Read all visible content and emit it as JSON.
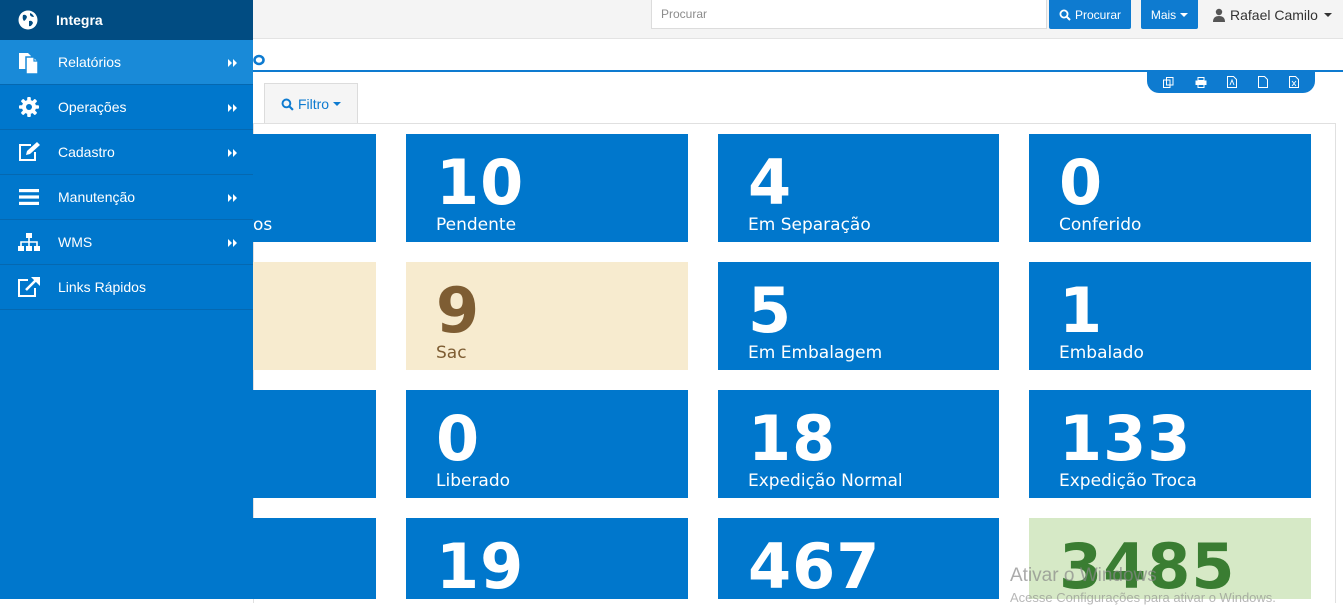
{
  "app": {
    "name": "Integra"
  },
  "topbar": {
    "search_placeholder": "Procurar",
    "search_button": "Procurar",
    "more_button": "Mais",
    "user_name": "Rafael Camilo"
  },
  "sidebar": {
    "items": [
      {
        "label": "Relatórios",
        "icon": "reports-icon"
      },
      {
        "label": "Operações",
        "icon": "gear-icon"
      },
      {
        "label": "Cadastro",
        "icon": "edit-icon"
      },
      {
        "label": "Manutenção",
        "icon": "list-icon"
      },
      {
        "label": "WMS",
        "icon": "sitemap-icon"
      },
      {
        "label": "Links Rápidos",
        "icon": "external-link-icon"
      }
    ]
  },
  "filter": {
    "label": "Filtro"
  },
  "tiles": [
    {
      "value": "",
      "label": "os"
    },
    {
      "value": "10",
      "label": "Pendente"
    },
    {
      "value": "4",
      "label": "Em Separação"
    },
    {
      "value": "0",
      "label": "Conferido"
    },
    {
      "value": "",
      "label": ""
    },
    {
      "value": "9",
      "label": "Sac"
    },
    {
      "value": "5",
      "label": "Em Embalagem"
    },
    {
      "value": "1",
      "label": "Embalado"
    },
    {
      "value": "",
      "label": ""
    },
    {
      "value": "0",
      "label": "Liberado"
    },
    {
      "value": "18",
      "label": "Expedição Normal"
    },
    {
      "value": "133",
      "label": "Expedição Troca"
    },
    {
      "value": "",
      "label": ""
    },
    {
      "value": "19",
      "label": ""
    },
    {
      "value": "467",
      "label": ""
    },
    {
      "value": "3485",
      "label": ""
    }
  ],
  "watermark": {
    "line1": "Ativar o Windows",
    "line2": "Acesse Configurações para ativar o Windows."
  },
  "colors": {
    "tile_blue": "#0077cc",
    "tile_beige": "#f7ebcf",
    "tile_green": "#d6e9c6",
    "sidebar_header": "#014c82",
    "accent": "#0e7bd0"
  }
}
